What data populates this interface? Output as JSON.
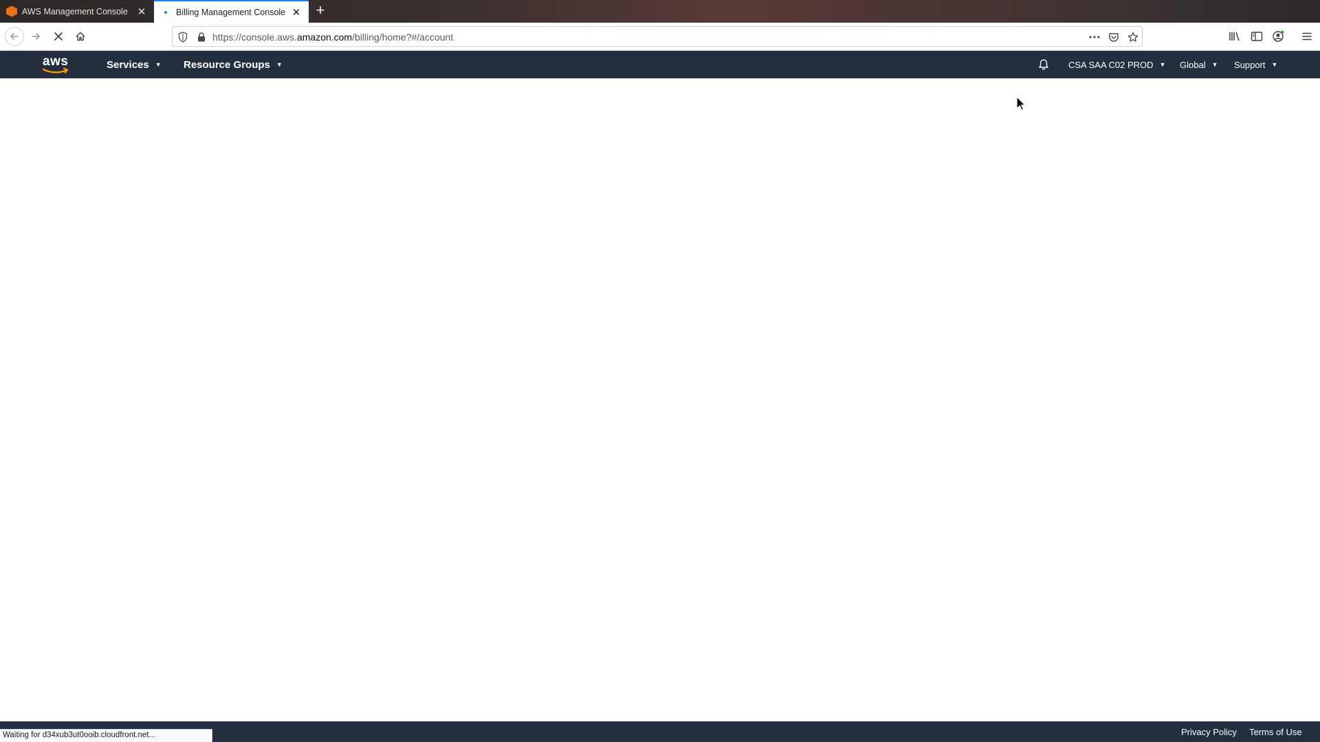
{
  "browser": {
    "tabs": [
      {
        "title": "AWS Management Console",
        "favicon": "aws-favicon-icon",
        "active": false
      },
      {
        "title": "Billing Management Console",
        "favicon": "loading-dot-icon",
        "active": true
      }
    ],
    "url": {
      "prefix": "https://console.aws.",
      "host": "amazon.com",
      "path": "/billing/home?#/account"
    },
    "status_text": "Waiting for d34xub3ut0ooib.cloudfront.net..."
  },
  "aws_header": {
    "logo_text": "aws",
    "services_label": "Services",
    "resource_groups_label": "Resource Groups",
    "account_label": "CSA SAA C02 PROD",
    "region_label": "Global",
    "support_label": "Support"
  },
  "footer": {
    "privacy_label": "Privacy Policy",
    "terms_label": "Terms of Use"
  },
  "colors": {
    "aws_header_bg": "#232f3e",
    "aws_orange": "#ff9900",
    "active_tab_accent": "#0a84ff"
  }
}
